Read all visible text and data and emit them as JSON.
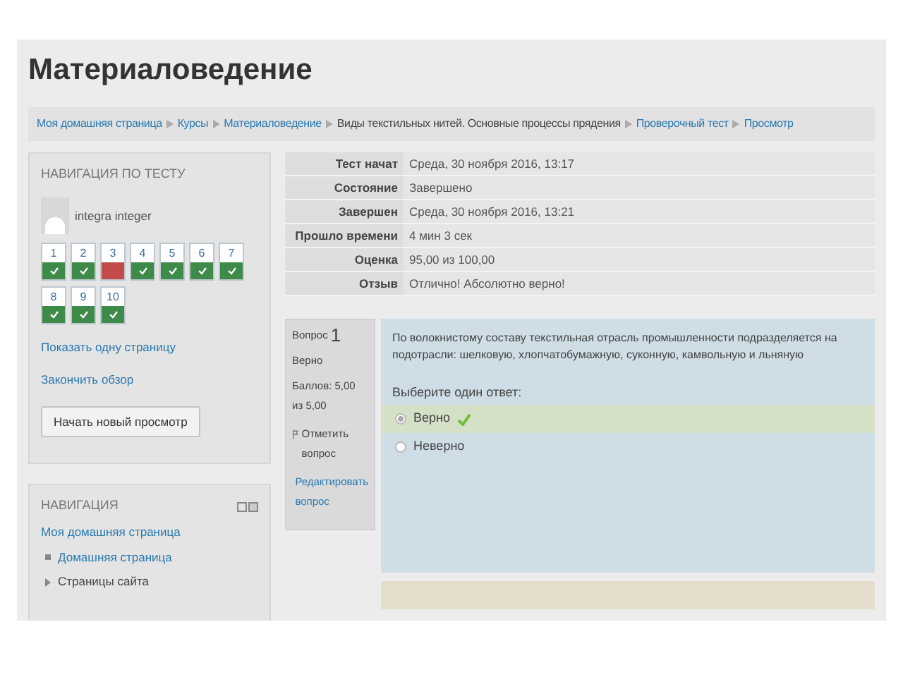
{
  "page_title": "Материаловедение",
  "breadcrumb": [
    {
      "label": "Моя домашняя страница",
      "link": true
    },
    {
      "label": "Курсы",
      "link": true
    },
    {
      "label": "Материаловедение",
      "link": true
    },
    {
      "label": "Виды текстильных нитей. Основные процессы прядения",
      "link": false
    },
    {
      "label": "Проверочный тест",
      "link": true
    },
    {
      "label": "Просмотр",
      "link": true
    }
  ],
  "quiz_nav": {
    "title": "НАВИГАЦИЯ ПО ТЕСТУ",
    "user": "integra integer",
    "questions": [
      {
        "number": "1",
        "correct": true
      },
      {
        "number": "2",
        "correct": true
      },
      {
        "number": "3",
        "correct": false
      },
      {
        "number": "4",
        "correct": true
      },
      {
        "number": "5",
        "correct": true
      },
      {
        "number": "6",
        "correct": true
      },
      {
        "number": "7",
        "correct": true
      },
      {
        "number": "8",
        "correct": true
      },
      {
        "number": "9",
        "correct": true
      },
      {
        "number": "10",
        "correct": true
      }
    ],
    "links": [
      "Показать одну страницу",
      "Закончить обзор"
    ],
    "button": "Начать новый просмотр"
  },
  "navigation": {
    "title": "НАВИГАЦИЯ",
    "items": [
      {
        "label": "Моя домашняя страница",
        "kind": "link"
      },
      {
        "label": "Домашняя страница",
        "kind": "bullet"
      },
      {
        "label": "Страницы сайта",
        "kind": "branch"
      }
    ]
  },
  "summary": [
    {
      "label": "Тест начат",
      "value": "Среда, 30 ноября 2016, 13:17"
    },
    {
      "label": "Состояние",
      "value": "Завершено"
    },
    {
      "label": "Завершен",
      "value": "Среда, 30 ноября 2016, 13:21"
    },
    {
      "label": "Прошло времени",
      "value": "4 мин 3 сек"
    },
    {
      "label": "Оценка",
      "value": "95,00 из 100,00"
    },
    {
      "label": "Отзыв",
      "value": "Отлично! Абсолютно верно!"
    }
  ],
  "question": {
    "number_label": "Вопрос",
    "number": "1",
    "status": "Верно",
    "marks": "Баллов: 5,00 из 5,00",
    "flag": "Отметить вопрос",
    "edit": "Редактировать вопрос",
    "text": "По волокнистому составу текстильная отрасль промышленности подразделяется на подотрасли: шелковую, хлопчатобумажную, суконную, камвольную и льняную",
    "prompt": "Выберите один ответ:",
    "answers": [
      {
        "label": "Верно",
        "selected": true,
        "correct": true
      },
      {
        "label": "Неверно",
        "selected": false,
        "correct": false
      }
    ]
  }
}
